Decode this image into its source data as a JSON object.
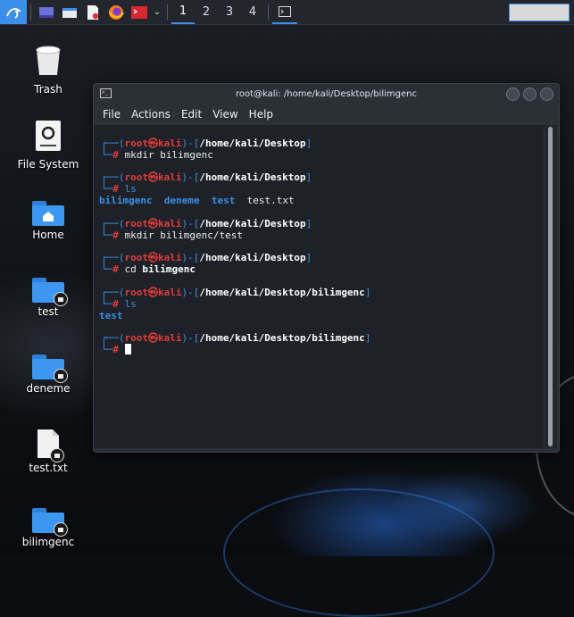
{
  "taskbar": {
    "icons": [
      "kali-menu-icon",
      "show-desktop-icon",
      "file-manager-icon",
      "text-editor-icon",
      "firefox-icon",
      "terminal-icon",
      "chevron-down-icon"
    ],
    "workspaces": [
      "1",
      "2",
      "3",
      "4"
    ],
    "active_workspace": "1"
  },
  "desktop": {
    "icons": [
      {
        "label": "Trash",
        "icon": "trash-icon"
      },
      {
        "label": "File System",
        "icon": "drive-icon"
      },
      {
        "label": "Home",
        "icon": "home-folder-icon"
      },
      {
        "label": "test",
        "icon": "folder-icon"
      },
      {
        "label": "deneme",
        "icon": "folder-icon"
      },
      {
        "label": "test.txt",
        "icon": "text-file-icon"
      },
      {
        "label": "bilimgenc",
        "icon": "folder-icon"
      }
    ]
  },
  "terminal": {
    "title": "root@kali: /home/kali/Desktop/bilimgenc",
    "menu": [
      "File",
      "Actions",
      "Edit",
      "View",
      "Help"
    ],
    "user": "root",
    "at_symbol": "㉿",
    "host": "kali",
    "blocks": [
      {
        "path": "/home/kali/Desktop",
        "command": "mkdir bilimgenc"
      },
      {
        "path": "/home/kali/Desktop",
        "command": "ls",
        "output_dirs": [
          "bilimgenc",
          "deneme",
          "test"
        ],
        "output_files": [
          "test.txt"
        ]
      },
      {
        "path": "/home/kali/Desktop",
        "command": "mkdir bilimgenc/test"
      },
      {
        "path": "/home/kali/Desktop",
        "command_name": "cd",
        "command_arg": "bilimgenc"
      },
      {
        "path": "/home/kali/Desktop/bilimgenc",
        "command": "ls",
        "output_dirs": [
          "test"
        ]
      },
      {
        "path": "/home/kali/Desktop/bilimgenc",
        "command": ""
      }
    ],
    "prompt_symbol": "#"
  }
}
